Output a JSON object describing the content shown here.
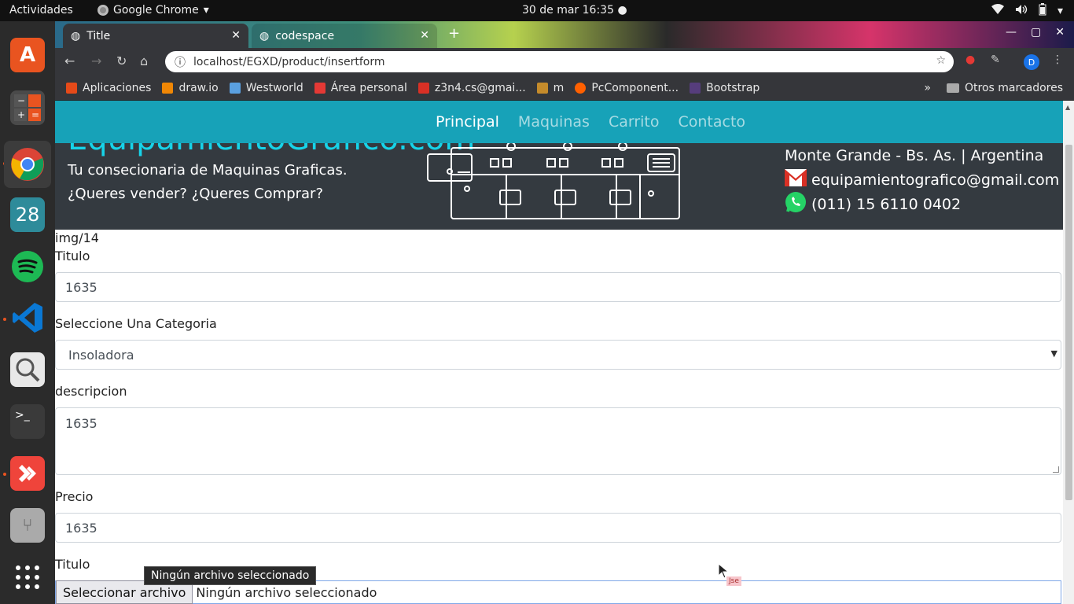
{
  "system": {
    "activities": "Actividades",
    "app_name": "Google Chrome",
    "clock": "30 de mar  16:35"
  },
  "dock": {
    "items": [
      "ubuntu-software-icon",
      "calculator-icon",
      "chrome-icon",
      "calendar-icon",
      "spotify-icon",
      "vscode-icon",
      "search-icon",
      "terminal-icon",
      "anydesk-icon",
      "usb-icon",
      "apps-grid-icon"
    ],
    "calendar_day": "28"
  },
  "tabs": [
    {
      "title": "Title"
    },
    {
      "title": "codespace"
    }
  ],
  "toolbar": {
    "url": "localhost/EGXD/product/insertform",
    "avatar_letter": "D"
  },
  "bookmarks": {
    "items": [
      {
        "label": "Aplicaciones",
        "color": "#e64a19"
      },
      {
        "label": "draw.io",
        "color": "#f08705"
      },
      {
        "label": "Westworld",
        "color": "#5aa0e0"
      },
      {
        "label": "Área personal",
        "color": "#e53935"
      },
      {
        "label": "z3n4.cs@gmai...",
        "color": "#d93025"
      },
      {
        "label": "m",
        "color": "#c58b2b"
      },
      {
        "label": "PcComponent...",
        "color": "#ff6000"
      },
      {
        "label": "Bootstrap",
        "color": "#563d7c"
      }
    ],
    "more": "»",
    "other": "Otros marcadores"
  },
  "navbar": {
    "items": [
      "Principal",
      "Maquinas",
      "Carrito",
      "Contacto"
    ]
  },
  "header": {
    "brand": "EquipamientoGrafico.com",
    "tagline": "Tu consecionaria de Maquinas Graficas.",
    "tagline2": "¿Queres vender? ¿Queres Comprar?",
    "location": "Monte Grande - Bs. As. | Argentina",
    "email": "equipamientografico@gmail.com",
    "phone": "(011) 15 6110 0402"
  },
  "form": {
    "img_path": "img/14",
    "titulo_label": "Titulo",
    "titulo_value": "1635",
    "categoria_label": "Seleccione Una Categoria",
    "categoria_value": "Insoladora",
    "descripcion_label": "descripcion",
    "descripcion_value": "1635",
    "precio_label": "Precio",
    "precio_value": "1635",
    "file_label": "Titulo",
    "file_button": "Seleccionar archivo",
    "file_status": "Ningún archivo seleccionado"
  },
  "tooltip": "Ningún archivo seleccionado",
  "cursor_badge": "Jse",
  "colors": {
    "navbar": "#17a2b8",
    "header": "#343a40",
    "brand": "#17d3e8"
  }
}
